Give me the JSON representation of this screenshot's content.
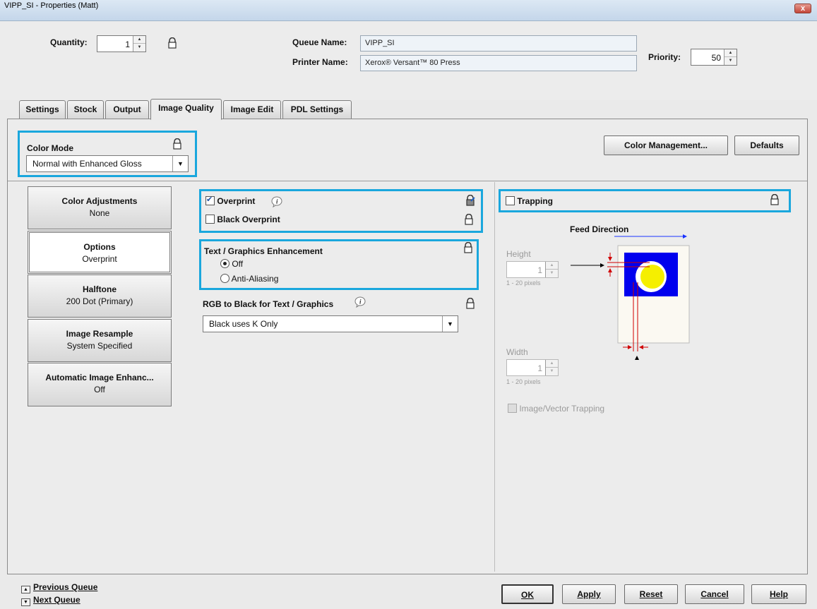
{
  "window": {
    "title": "VIPP_SI - Properties (Matt)",
    "close_glyph": "x"
  },
  "header": {
    "quantity_label": "Quantity:",
    "quantity_value": "1",
    "queue_name_label": "Queue Name:",
    "queue_name_value": "VIPP_SI",
    "printer_name_label": "Printer Name:",
    "printer_name_value": "Xerox® Versant™ 80 Press",
    "priority_label": "Priority:",
    "priority_value": "50"
  },
  "tabs": [
    {
      "label": "Settings"
    },
    {
      "label": "Stock"
    },
    {
      "label": "Output"
    },
    {
      "label": "Image Quality"
    },
    {
      "label": "Image Edit"
    },
    {
      "label": "PDL Settings"
    }
  ],
  "active_tab": "Image Quality",
  "color_mode": {
    "label": "Color Mode",
    "value": "Normal with Enhanced Gloss"
  },
  "buttons": {
    "color_management": "Color Management...",
    "defaults": "Defaults"
  },
  "nav": [
    {
      "title": "Color Adjustments",
      "sub": "None"
    },
    {
      "title": "Options",
      "sub": "Overprint"
    },
    {
      "title": "Halftone",
      "sub": "200 Dot (Primary)"
    },
    {
      "title": "Image Resample",
      "sub": "System Specified"
    },
    {
      "title": "Automatic Image Enhanc...",
      "sub": "Off"
    }
  ],
  "options": {
    "overprint": {
      "label": "Overprint",
      "checked": true
    },
    "black_overprint": {
      "label": "Black Overprint",
      "checked": false
    },
    "text_graphics": {
      "label": "Text / Graphics Enhancement",
      "opt_off": "Off",
      "opt_aa": "Anti-Aliasing",
      "selected": "Off"
    },
    "rgb_black": {
      "label": "RGB to Black for Text / Graphics",
      "value": "Black uses K Only"
    }
  },
  "trapping": {
    "label": "Trapping",
    "checked": false,
    "feed_direction": "Feed Direction",
    "height_label": "Height",
    "height_value": "1",
    "height_range": "1 - 20 pixels",
    "width_label": "Width",
    "width_value": "1",
    "width_range": "1 - 20 pixels",
    "image_vector": "Image/Vector Trapping"
  },
  "footer": {
    "previous_queue": "Previous Queue",
    "next_queue": "Next Queue",
    "ok": "OK",
    "apply": "Apply",
    "reset": "Reset",
    "cancel": "Cancel",
    "help": "Help"
  },
  "colors": {
    "highlight": "#1aa7dd",
    "trap_blue": "#0000ee",
    "trap_yellow": "#f5ef00",
    "trap_red": "#d00000"
  },
  "icons": [
    "lock-icon",
    "unlock-icon",
    "info-icon",
    "close-icon",
    "dropdown-arrow-icon",
    "spinner-icon"
  ]
}
